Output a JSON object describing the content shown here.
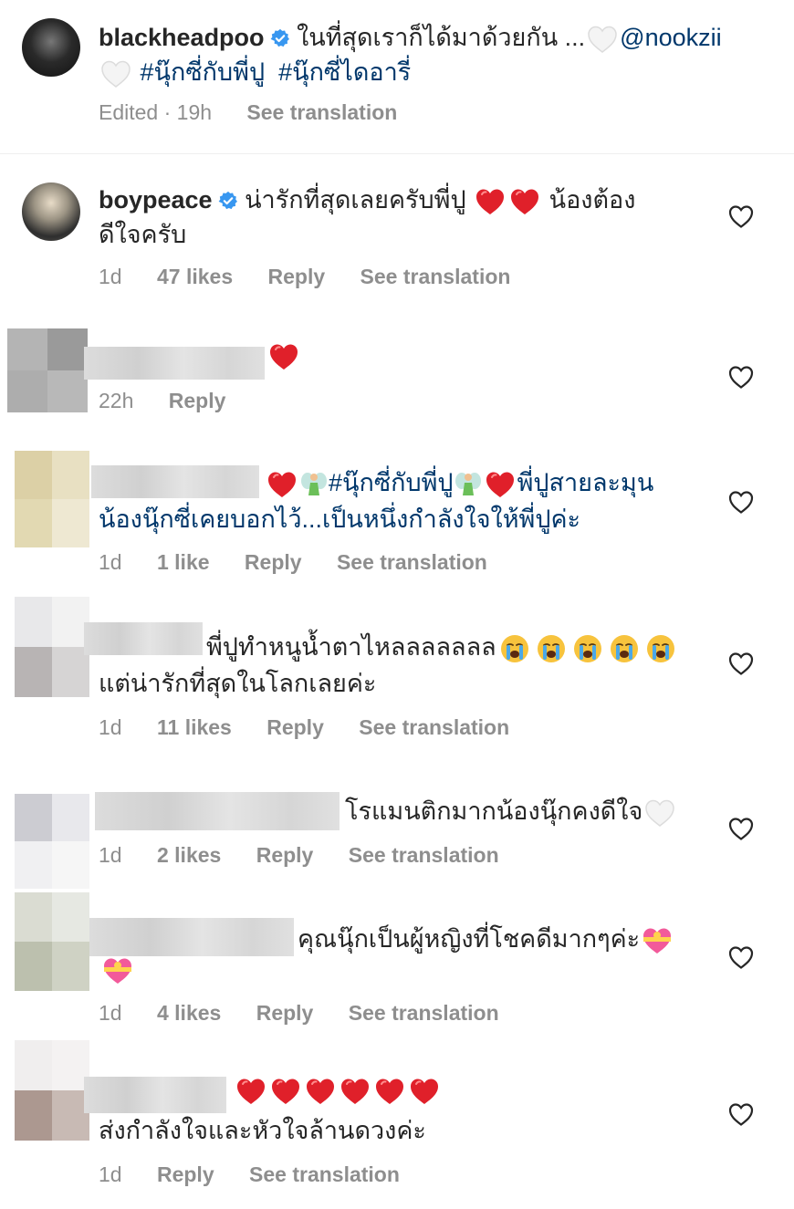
{
  "post": {
    "username": "blackheadpoo",
    "caption_text": "ในที่สุดเราก็ได้มาด้วยกัน ...",
    "mention": "@nookzii",
    "hashtag1": "#นุ๊กซี่กับพี่ปู",
    "hashtag2": "#นุ๊กซี่ไดอารี่",
    "edited_time": "Edited · 19h",
    "see_translation": "See translation"
  },
  "comments": [
    {
      "username": "boypeace",
      "line1": "น่ารักที่สุดเลยครับพี่ปู",
      "line1b": "น้องต้อง",
      "line2": "ดีใจครับ",
      "time": "1d",
      "likes": "47 likes",
      "reply": "Reply",
      "see_translation": "See translation"
    },
    {
      "time": "22h",
      "reply": "Reply"
    },
    {
      "tag": "#นุ๊กซี่กับพี่ปู",
      "line1b": "พี่ปูสายละมุน",
      "line2": "น้องนุ๊กซี่เคยบอกไว้...เป็นหนึ่งกำลังใจให้พี่ปูค่ะ",
      "time": "1d",
      "likes": "1 like",
      "reply": "Reply",
      "see_translation": "See translation"
    },
    {
      "line1": "พี่ปูทำหนูน้ำตาไหลลลลลลล",
      "line2": "แต่น่ารักที่สุดในโลกเลยค่ะ",
      "time": "1d",
      "likes": "11 likes",
      "reply": "Reply",
      "see_translation": "See translation"
    },
    {
      "line1": "โรแมนติกมากน้องนุ๊กคงดีใจ",
      "time": "1d",
      "likes": "2 likes",
      "reply": "Reply",
      "see_translation": "See translation"
    },
    {
      "line1": "คุณนุ๊กเป็นผู้หญิงที่โชคดีมากๆค่ะ",
      "time": "1d",
      "likes": "4 likes",
      "reply": "Reply",
      "see_translation": "See translation"
    },
    {
      "line2": "ส่งกำลังใจและหัวใจล้านดวงค่ะ",
      "time": "1d",
      "reply": "Reply",
      "see_translation": "See translation"
    }
  ],
  "colors": {
    "link": "#00376b",
    "meta": "#8e8e8e",
    "text": "#262626",
    "heart_red": "#e0202a",
    "verified": "#3897f0"
  },
  "icons": {
    "verified": "verified-badge-icon",
    "like": "heart-outline-icon"
  }
}
